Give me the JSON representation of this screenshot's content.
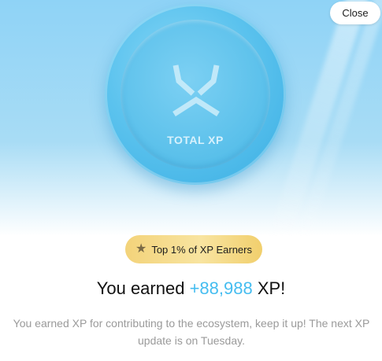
{
  "close_button": {
    "label": "Close"
  },
  "coin": {
    "label": "TOTAL XP",
    "logo_icon": "xp-logo-icon"
  },
  "badge": {
    "star_icon": "star-icon",
    "text": "Top 1% of XP Earners"
  },
  "headline": {
    "prefix": "You earned ",
    "amount": "+88,988",
    "suffix": " XP!"
  },
  "description": "You earned XP for contributing to the ecosystem, keep it up! The next XP update is on Tuesday.",
  "colors": {
    "accent": "#45bdf0",
    "coin": "#5cc3ee",
    "badge_gold": "#f3d37a",
    "muted_text": "#9a9a9a"
  }
}
